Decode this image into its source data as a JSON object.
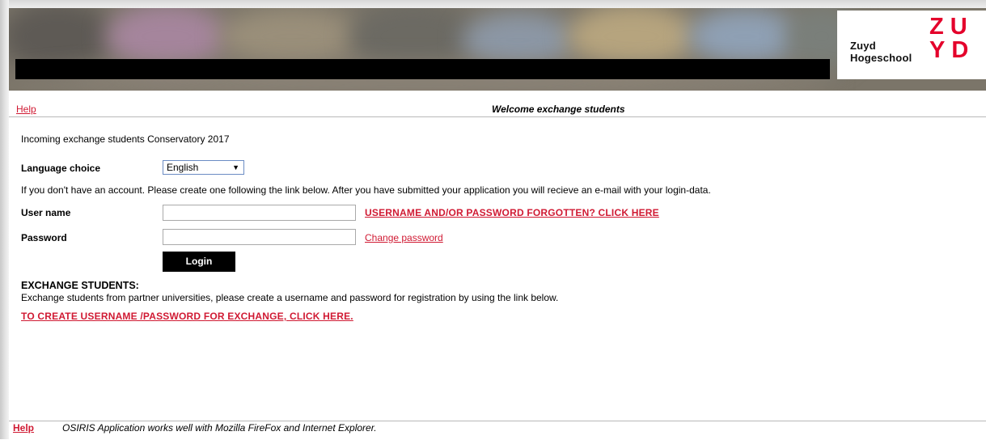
{
  "header": {
    "help_label": "Help",
    "welcome_title": "Welcome exchange students"
  },
  "logo": {
    "school_line1": "Zuyd",
    "school_line2": "Hogeschool",
    "mark_line1": "ZU",
    "mark_line2": "YD",
    "brand_color": "#e4002b"
  },
  "form": {
    "intro": "Incoming exchange students Conservatory 2017",
    "language_label": "Language choice",
    "language_selected": "English",
    "account_notice": "If you don't have an account. Please create one following the link below. After you have submitted your application you will recieve an e-mail with your login-data.",
    "username_label": "User name",
    "username_value": "",
    "forgot_link": "USERNAME AND/OR PASSWORD FORGOTTEN? CLICK HERE",
    "password_label": "Password",
    "password_value": "",
    "change_password_link": "Change password",
    "login_button": "Login"
  },
  "exchange": {
    "title": "EXCHANGE STUDENTS:",
    "text": "Exchange students from partner universities, please create a username and password for registration by using the link below.",
    "create_link": "TO CREATE USERNAME /PASSWORD FOR EXCHANGE, CLICK HERE."
  },
  "footer": {
    "help_label": "Help",
    "note": "OSIRIS Application works well with Mozilla FireFox and Internet Explorer."
  },
  "colors": {
    "link": "#d01a33",
    "button_bg": "#000000"
  }
}
